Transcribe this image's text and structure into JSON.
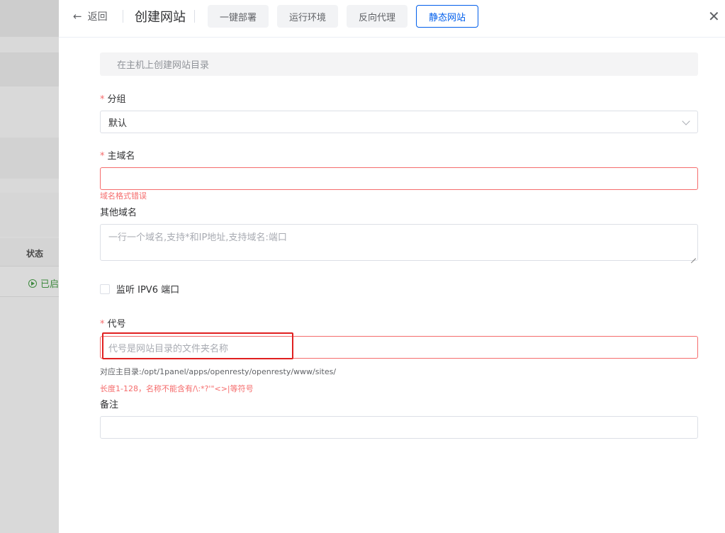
{
  "background": {
    "status_header": "状态",
    "status_value": "已启"
  },
  "header": {
    "back_label": "返回",
    "title": "创建网站",
    "tabs": [
      {
        "label": "一键部署",
        "active": false
      },
      {
        "label": "运行环境",
        "active": false
      },
      {
        "label": "反向代理",
        "active": false
      },
      {
        "label": "静态网站",
        "active": true
      }
    ]
  },
  "form": {
    "alert": "在主机上创建网站目录",
    "group": {
      "label": "分组",
      "required": true,
      "value": "默认"
    },
    "primary_domain": {
      "label": "主域名",
      "required": true,
      "value": "",
      "error": "域名格式错误"
    },
    "other_domains": {
      "label": "其他域名",
      "placeholder": "一行一个域名,支持*和IP地址,支持域名:端口"
    },
    "ipv6": {
      "label": "监听 IPV6 端口",
      "checked": false
    },
    "alias": {
      "label": "代号",
      "required": true,
      "placeholder": "代号是网站目录的文件夹名称",
      "hint": "对应主目录:/opt/1panel/apps/openresty/openresty/www/sites/",
      "error": "长度1-128，名称不能含有/\\:*?'\"<>|等符号"
    },
    "remark": {
      "label": "备注",
      "value": ""
    }
  },
  "colors": {
    "primary": "#005eeb",
    "error": "#f56c6c",
    "highlight_box": "#e02020"
  }
}
